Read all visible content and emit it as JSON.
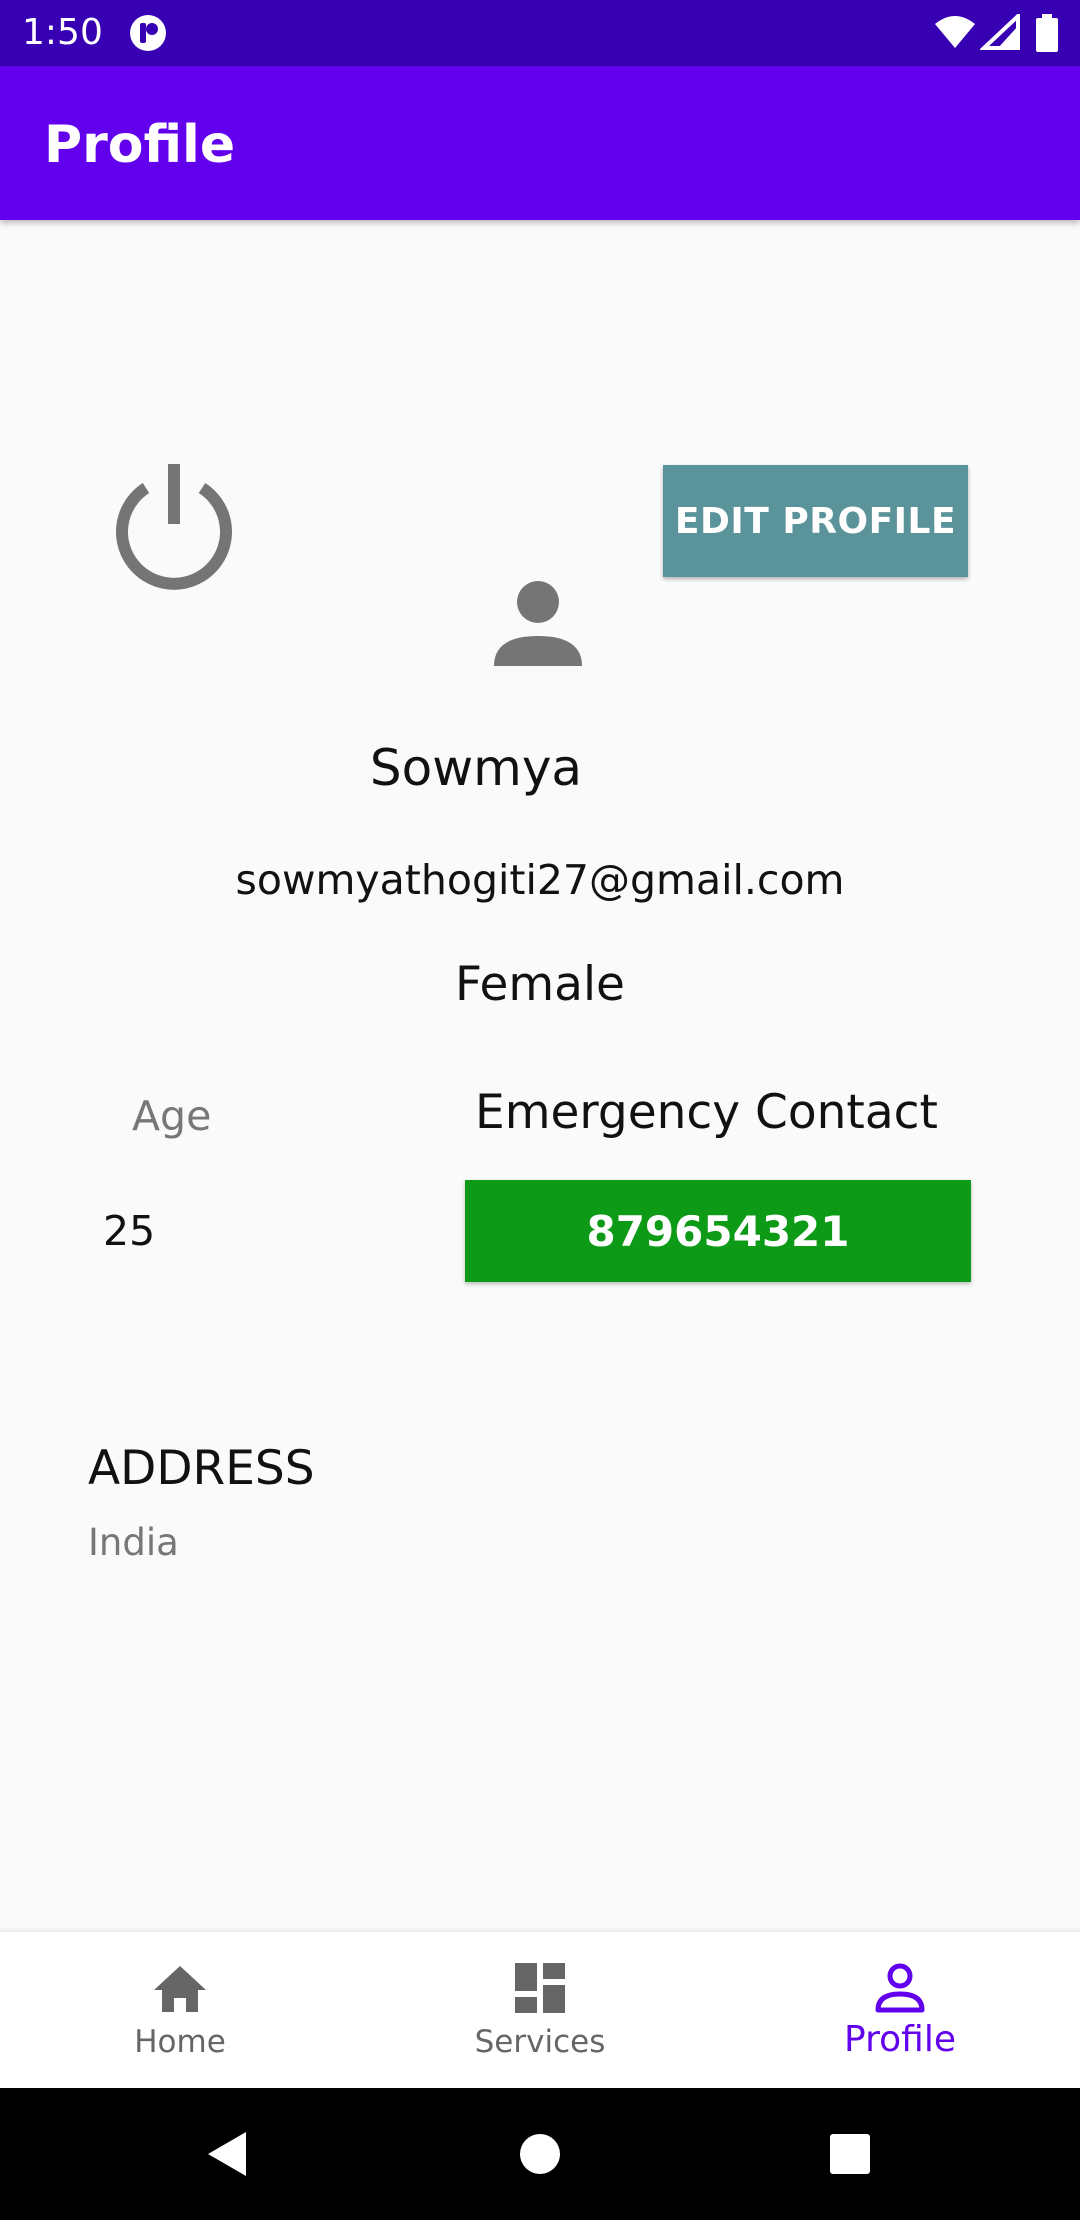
{
  "status_bar": {
    "time": "1:50",
    "icons": [
      "app-notification-icon",
      "wifi-icon",
      "signal-icon",
      "battery-icon"
    ]
  },
  "app_bar": {
    "title": "Profile"
  },
  "profile": {
    "power_icon": "power-icon",
    "edit_button_label": "EDIT PROFILE",
    "avatar_icon": "person-icon",
    "name": "Sowmya",
    "email": "sowmyathogiti27@gmail.com",
    "gender": "Female",
    "age_label": "Age",
    "age_value": "25",
    "emergency_label": "Emergency Contact",
    "emergency_number": "879654321",
    "address_label": "ADDRESS",
    "address_value": "India"
  },
  "bottom_nav": {
    "items": [
      {
        "label": "Home",
        "icon": "home-icon",
        "active": false
      },
      {
        "label": "Services",
        "icon": "dashboard-icon",
        "active": false
      },
      {
        "label": "Profile",
        "icon": "person-outline-icon",
        "active": true
      }
    ]
  },
  "system_nav": [
    "back-icon",
    "home-circle-icon",
    "recents-icon"
  ],
  "colors": {
    "status_bar": "#3700b3",
    "app_bar": "#6200ee",
    "edit_button": "#5a9399",
    "emergency_button": "#0d9a17",
    "active_nav": "#6200ee",
    "inactive_nav": "#666666",
    "icon_gray": "#757575"
  }
}
